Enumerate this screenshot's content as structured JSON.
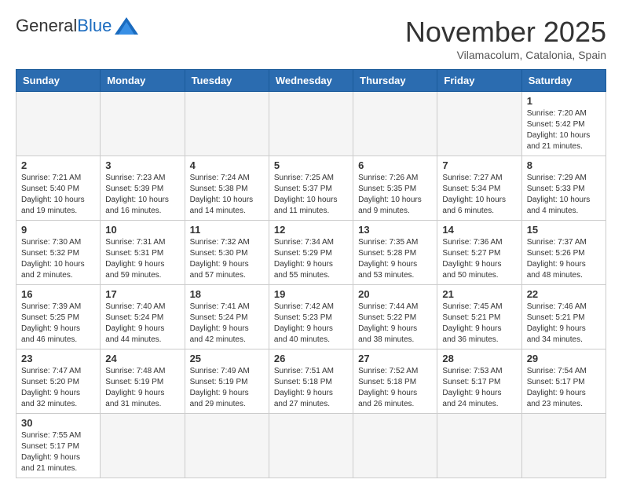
{
  "header": {
    "logo_general": "General",
    "logo_blue": "Blue",
    "month_title": "November 2025",
    "location": "Vilamacolum, Catalonia, Spain"
  },
  "weekdays": [
    "Sunday",
    "Monday",
    "Tuesday",
    "Wednesday",
    "Thursday",
    "Friday",
    "Saturday"
  ],
  "weeks": [
    [
      {
        "day": "",
        "info": ""
      },
      {
        "day": "",
        "info": ""
      },
      {
        "day": "",
        "info": ""
      },
      {
        "day": "",
        "info": ""
      },
      {
        "day": "",
        "info": ""
      },
      {
        "day": "",
        "info": ""
      },
      {
        "day": "1",
        "info": "Sunrise: 7:20 AM\nSunset: 5:42 PM\nDaylight: 10 hours and 21 minutes."
      }
    ],
    [
      {
        "day": "2",
        "info": "Sunrise: 7:21 AM\nSunset: 5:40 PM\nDaylight: 10 hours and 19 minutes."
      },
      {
        "day": "3",
        "info": "Sunrise: 7:23 AM\nSunset: 5:39 PM\nDaylight: 10 hours and 16 minutes."
      },
      {
        "day": "4",
        "info": "Sunrise: 7:24 AM\nSunset: 5:38 PM\nDaylight: 10 hours and 14 minutes."
      },
      {
        "day": "5",
        "info": "Sunrise: 7:25 AM\nSunset: 5:37 PM\nDaylight: 10 hours and 11 minutes."
      },
      {
        "day": "6",
        "info": "Sunrise: 7:26 AM\nSunset: 5:35 PM\nDaylight: 10 hours and 9 minutes."
      },
      {
        "day": "7",
        "info": "Sunrise: 7:27 AM\nSunset: 5:34 PM\nDaylight: 10 hours and 6 minutes."
      },
      {
        "day": "8",
        "info": "Sunrise: 7:29 AM\nSunset: 5:33 PM\nDaylight: 10 hours and 4 minutes."
      }
    ],
    [
      {
        "day": "9",
        "info": "Sunrise: 7:30 AM\nSunset: 5:32 PM\nDaylight: 10 hours and 2 minutes."
      },
      {
        "day": "10",
        "info": "Sunrise: 7:31 AM\nSunset: 5:31 PM\nDaylight: 9 hours and 59 minutes."
      },
      {
        "day": "11",
        "info": "Sunrise: 7:32 AM\nSunset: 5:30 PM\nDaylight: 9 hours and 57 minutes."
      },
      {
        "day": "12",
        "info": "Sunrise: 7:34 AM\nSunset: 5:29 PM\nDaylight: 9 hours and 55 minutes."
      },
      {
        "day": "13",
        "info": "Sunrise: 7:35 AM\nSunset: 5:28 PM\nDaylight: 9 hours and 53 minutes."
      },
      {
        "day": "14",
        "info": "Sunrise: 7:36 AM\nSunset: 5:27 PM\nDaylight: 9 hours and 50 minutes."
      },
      {
        "day": "15",
        "info": "Sunrise: 7:37 AM\nSunset: 5:26 PM\nDaylight: 9 hours and 48 minutes."
      }
    ],
    [
      {
        "day": "16",
        "info": "Sunrise: 7:39 AM\nSunset: 5:25 PM\nDaylight: 9 hours and 46 minutes."
      },
      {
        "day": "17",
        "info": "Sunrise: 7:40 AM\nSunset: 5:24 PM\nDaylight: 9 hours and 44 minutes."
      },
      {
        "day": "18",
        "info": "Sunrise: 7:41 AM\nSunset: 5:24 PM\nDaylight: 9 hours and 42 minutes."
      },
      {
        "day": "19",
        "info": "Sunrise: 7:42 AM\nSunset: 5:23 PM\nDaylight: 9 hours and 40 minutes."
      },
      {
        "day": "20",
        "info": "Sunrise: 7:44 AM\nSunset: 5:22 PM\nDaylight: 9 hours and 38 minutes."
      },
      {
        "day": "21",
        "info": "Sunrise: 7:45 AM\nSunset: 5:21 PM\nDaylight: 9 hours and 36 minutes."
      },
      {
        "day": "22",
        "info": "Sunrise: 7:46 AM\nSunset: 5:21 PM\nDaylight: 9 hours and 34 minutes."
      }
    ],
    [
      {
        "day": "23",
        "info": "Sunrise: 7:47 AM\nSunset: 5:20 PM\nDaylight: 9 hours and 32 minutes."
      },
      {
        "day": "24",
        "info": "Sunrise: 7:48 AM\nSunset: 5:19 PM\nDaylight: 9 hours and 31 minutes."
      },
      {
        "day": "25",
        "info": "Sunrise: 7:49 AM\nSunset: 5:19 PM\nDaylight: 9 hours and 29 minutes."
      },
      {
        "day": "26",
        "info": "Sunrise: 7:51 AM\nSunset: 5:18 PM\nDaylight: 9 hours and 27 minutes."
      },
      {
        "day": "27",
        "info": "Sunrise: 7:52 AM\nSunset: 5:18 PM\nDaylight: 9 hours and 26 minutes."
      },
      {
        "day": "28",
        "info": "Sunrise: 7:53 AM\nSunset: 5:17 PM\nDaylight: 9 hours and 24 minutes."
      },
      {
        "day": "29",
        "info": "Sunrise: 7:54 AM\nSunset: 5:17 PM\nDaylight: 9 hours and 23 minutes."
      }
    ],
    [
      {
        "day": "30",
        "info": "Sunrise: 7:55 AM\nSunset: 5:17 PM\nDaylight: 9 hours and 21 minutes."
      },
      {
        "day": "",
        "info": ""
      },
      {
        "day": "",
        "info": ""
      },
      {
        "day": "",
        "info": ""
      },
      {
        "day": "",
        "info": ""
      },
      {
        "day": "",
        "info": ""
      },
      {
        "day": "",
        "info": ""
      }
    ]
  ]
}
